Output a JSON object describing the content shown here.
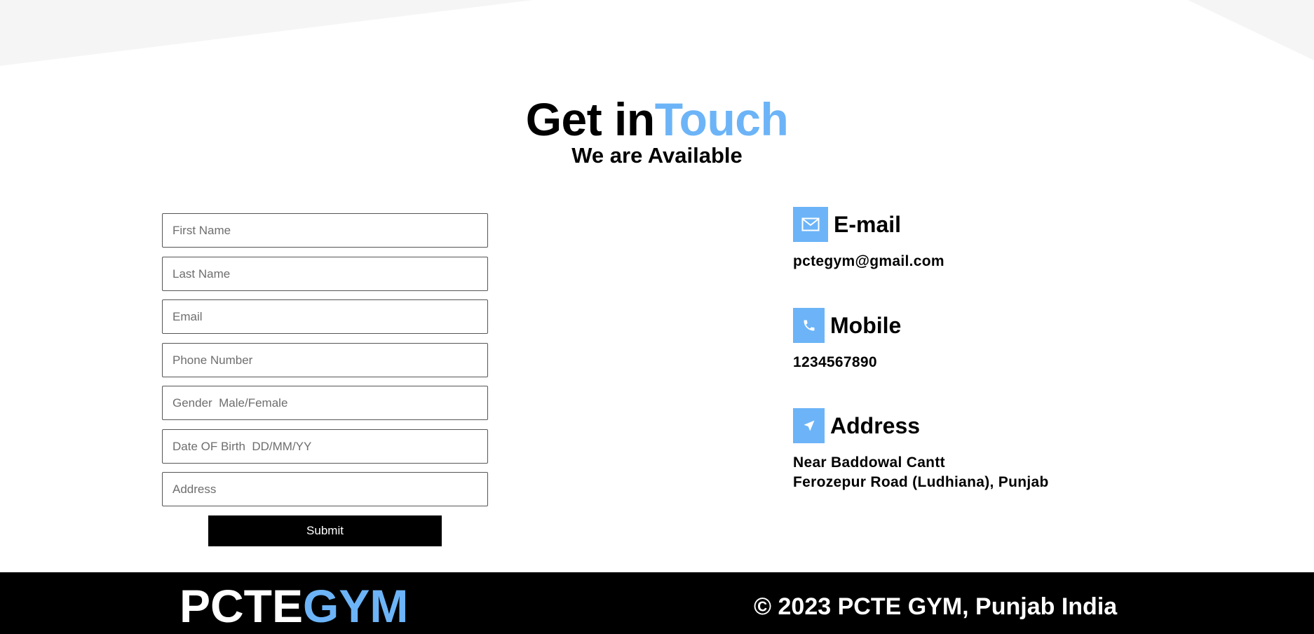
{
  "heading": {
    "title_part1": "Get in",
    "title_part2": "Touch",
    "subtitle": "We are Available"
  },
  "form": {
    "first_name_placeholder": "First Name",
    "last_name_placeholder": "Last Name",
    "email_placeholder": "Email",
    "phone_placeholder": "Phone Number",
    "gender_placeholder": "Gender  Male/Female",
    "dob_placeholder": "Date OF Birth  DD/MM/YY",
    "address_placeholder": "Address",
    "submit_label": "Submit"
  },
  "contact": {
    "email_label": "E-mail",
    "email_value": "pctegym@gmail.com",
    "mobile_label": "Mobile",
    "mobile_value": "1234567890",
    "address_label": "Address",
    "address_line1": "Near Baddowal Cantt",
    "address_line2": "Ferozepur Road (Ludhiana), Punjab"
  },
  "icons": {
    "email": "envelope-icon",
    "mobile": "phone-icon",
    "address": "location-arrow-icon"
  },
  "footer": {
    "brand_part1": "PCTE",
    "brand_part2": "GYM",
    "copyright": "© 2023 PCTE GYM, Punjab India"
  },
  "colors": {
    "accent": "#6cb4f7",
    "footer_bg": "#000000",
    "background_shape": "#f5f5f5"
  }
}
